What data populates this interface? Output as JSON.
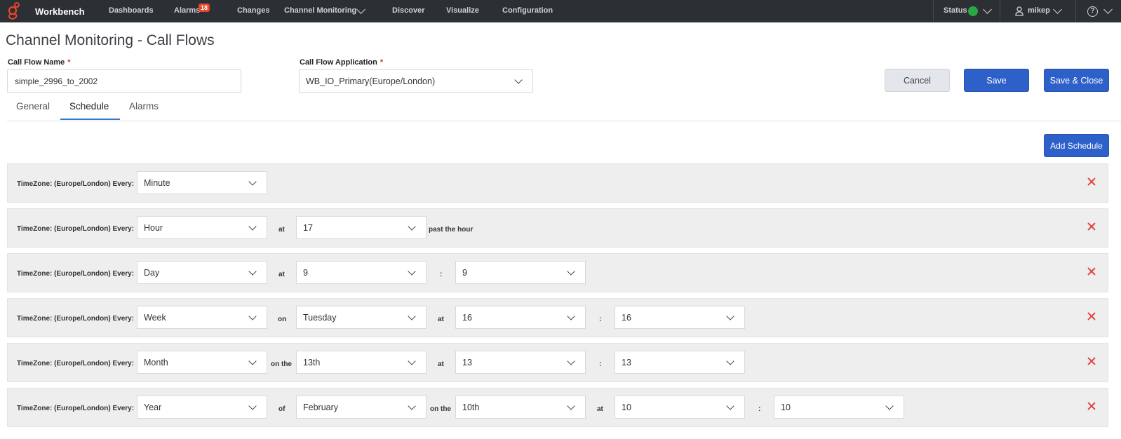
{
  "nav": {
    "brand": "Workbench",
    "items": [
      "Dashboards",
      "Alarms",
      "Changes",
      "Channel Monitoring",
      "Discover",
      "Visualize",
      "Configuration"
    ],
    "alarm_count": "18",
    "status_label": "Status",
    "user": "mikep",
    "help": "?",
    "status_color": "#29a745"
  },
  "page": {
    "title": "Channel Monitoring - Call Flows"
  },
  "form": {
    "name_label": "Call Flow Name",
    "name_value": "simple_2996_to_2002",
    "app_label": "Call Flow Application",
    "app_value": "WB_IO_Primary(Europe/London)",
    "required_mark": "*"
  },
  "buttons": {
    "cancel": "Cancel",
    "save": "Save",
    "save_close": "Save & Close",
    "add_schedule": "Add Schedule"
  },
  "tabs": [
    "General",
    "Schedule",
    "Alarms"
  ],
  "schedule": {
    "row_label": "TimeZone: (Europe/London) Every:",
    "rows": [
      {
        "every": "Minute"
      },
      {
        "every": "Hour",
        "c1": "at",
        "v1": "17",
        "c2": "past the hour"
      },
      {
        "every": "Day",
        "c1": "at",
        "v1": "9",
        "c2": ":",
        "v2": "9"
      },
      {
        "every": "Week",
        "c1": "on",
        "v1": "Tuesday",
        "c2": "at",
        "v2": "16",
        "c3": ":",
        "v3": "16"
      },
      {
        "every": "Month",
        "c1": "on the",
        "v1": "13th",
        "c2": "at",
        "v2": "13",
        "c3": ":",
        "v3": "13"
      },
      {
        "every": "Year",
        "c1": "of",
        "v1": "February",
        "c2": "on the",
        "v2": "10th",
        "c3": "at",
        "v3": "10",
        "c4": ":",
        "v4": "10"
      }
    ]
  },
  "colors": {
    "nav_bg": "#2c2f33",
    "primary": "#2e60c9",
    "remove": "#e0473c"
  }
}
